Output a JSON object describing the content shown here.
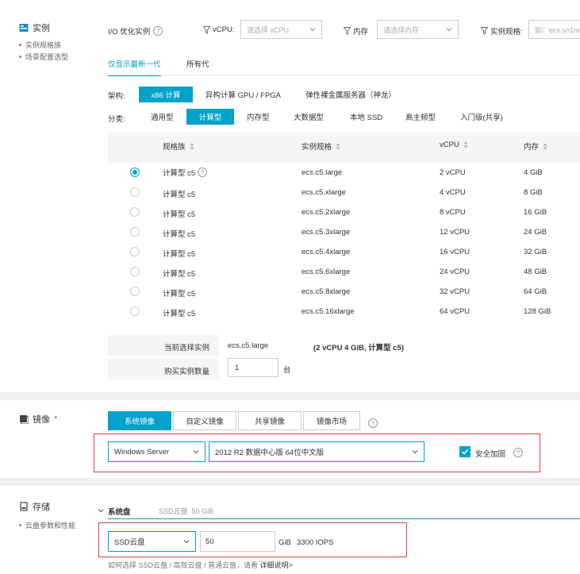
{
  "instance": {
    "title": "实例",
    "side_links": [
      "实例规格族",
      "场景配置选型"
    ],
    "filters": {
      "io_label": "I/O 优化实例",
      "vcpu_label": "vCPU:",
      "vcpu_placeholder": "请选择 vCPU",
      "mem_label": "内存",
      "mem_placeholder": "请选择内存",
      "spec_label": "实例规格:",
      "spec_placeholder": "如：ecs.sn1ne"
    },
    "gen_tabs": [
      "仅显示最新一代",
      "所有代"
    ],
    "arch_label": "架构:",
    "arch_options": [
      "x86 计算",
      "异构计算 GPU / FPGA",
      "弹性裸金属服务器（神龙）"
    ],
    "category_label": "分类:",
    "category_options": [
      "通用型",
      "计算型",
      "内存型",
      "大数据型",
      "本地 SSD",
      "高主频型",
      "入门级(共享)"
    ],
    "table": {
      "headers": [
        "规格族",
        "实例规格",
        "vCPU",
        "内存"
      ],
      "rows": [
        {
          "family": "计算型 c5",
          "spec": "ecs.c5.large",
          "vcpu": "2 vCPU",
          "mem": "4 GiB",
          "selected": true
        },
        {
          "family": "计算型 c5",
          "spec": "ecs.c5.xlarge",
          "vcpu": "4 vCPU",
          "mem": "8 GiB",
          "selected": false
        },
        {
          "family": "计算型 c5",
          "spec": "ecs.c5.2xlarge",
          "vcpu": "8 vCPU",
          "mem": "16 GiB",
          "selected": false
        },
        {
          "family": "计算型 c5",
          "spec": "ecs.c5.3xlarge",
          "vcpu": "12 vCPU",
          "mem": "24 GiB",
          "selected": false
        },
        {
          "family": "计算型 c5",
          "spec": "ecs.c5.4xlarge",
          "vcpu": "16 vCPU",
          "mem": "32 GiB",
          "selected": false
        },
        {
          "family": "计算型 c5",
          "spec": "ecs.c5.6xlarge",
          "vcpu": "24 vCPU",
          "mem": "48 GiB",
          "selected": false
        },
        {
          "family": "计算型 c5",
          "spec": "ecs.c5.8xlarge",
          "vcpu": "32 vCPU",
          "mem": "64 GiB",
          "selected": false
        },
        {
          "family": "计算型 c5",
          "spec": "ecs.c5.16xlarge",
          "vcpu": "64 vCPU",
          "mem": "128 GiB",
          "selected": false
        }
      ]
    },
    "current_label": "当前选择实例",
    "current_value": "ecs.c5.large",
    "current_detail": "(2 vCPU 4 GiB, 计算型 c5)",
    "qty_label": "购买实例数量",
    "qty_value": "1",
    "qty_unit": "台"
  },
  "image": {
    "title": "镜像",
    "required_mark": "*",
    "tabs": [
      "系统镜像",
      "自定义镜像",
      "共享镜像",
      "镜像市场"
    ],
    "os_value": "Windows Server",
    "version_value": "2012 R2 数据中心版 64位中文版",
    "security_label": "安全加固",
    "security_checked": true
  },
  "storage": {
    "title": "存储",
    "side_link": "云盘参数和性能",
    "sys_disk_label": "系统盘",
    "sys_disk_summary": "SSD云盘  50 GiB",
    "disk_type": "SSD云盘",
    "disk_size": "50",
    "disk_unit": "GiB",
    "iops": "3300 IOPS",
    "hint": "如何选择 SSD云盘 / 高效云盘 / 普通云盘，请看",
    "hint_link": "详细说明>"
  },
  "colors": {
    "accent": "#00a2ca",
    "highlight": "#d9404b",
    "bg": "#f0f0f0"
  },
  "icons": [
    "instance-icon",
    "image-icon",
    "storage-icon",
    "filter-icon",
    "help-icon",
    "chevron-down-icon",
    "sort-icon",
    "check-icon"
  ]
}
